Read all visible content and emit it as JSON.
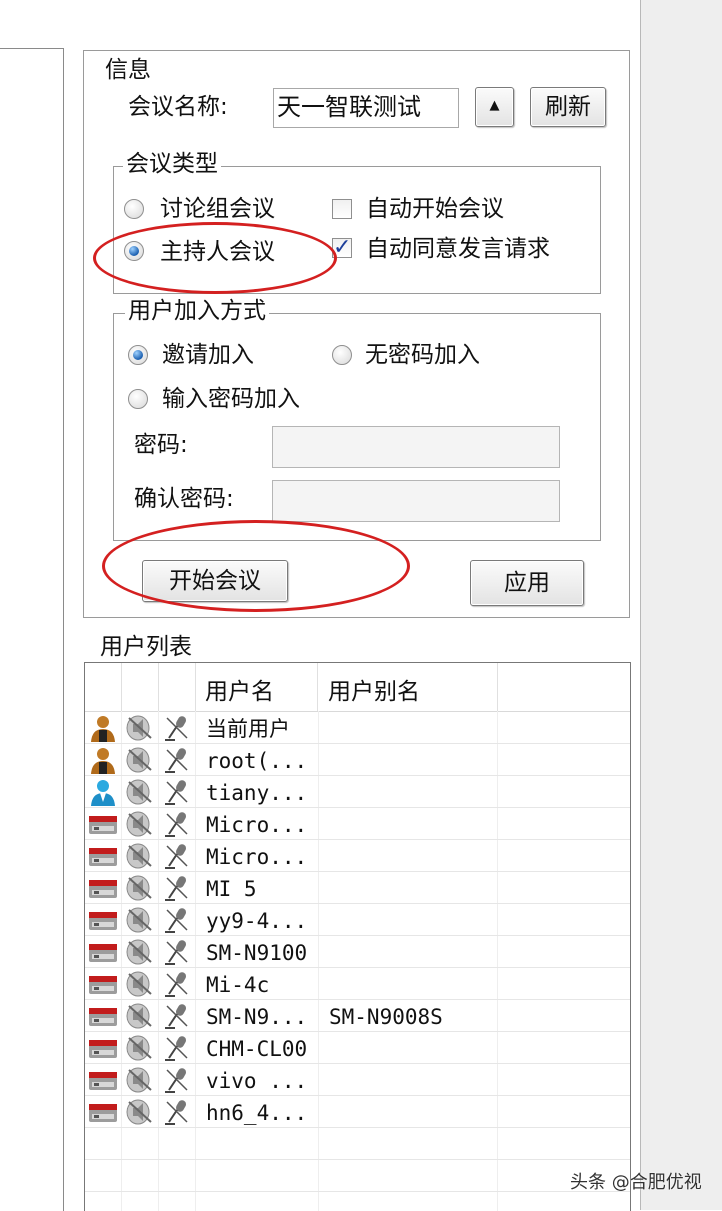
{
  "info": {
    "title": "信息",
    "meeting_name_label": "会议名称:",
    "meeting_name_value": "天一智联测试",
    "up_button": "▲",
    "refresh_button": "刷新"
  },
  "meeting_type": {
    "title": "会议类型",
    "options": [
      "讨论组会议",
      "主持人会议"
    ],
    "selected": "主持人会议",
    "checks": [
      {
        "label": "自动开始会议",
        "checked": false
      },
      {
        "label": "自动同意发言请求",
        "checked": true
      }
    ]
  },
  "join_mode": {
    "title": "用户加入方式",
    "options": [
      "邀请加入",
      "无密码加入",
      "输入密码加入"
    ],
    "selected": "邀请加入",
    "password_label": "密码:",
    "confirm_label": "确认密码:"
  },
  "actions": {
    "start": "开始会议",
    "apply": "应用"
  },
  "user_list": {
    "title": "用户列表",
    "columns": [
      "用户名",
      "用户别名"
    ],
    "rows": [
      {
        "name": "当前用户",
        "alias": "",
        "type": "person-icon"
      },
      {
        "name": "root(...",
        "alias": "",
        "type": "person-icon"
      },
      {
        "name": "tiany...",
        "alias": "",
        "type": "user-blue-icon"
      },
      {
        "name": "Micro...",
        "alias": "",
        "type": "device-icon"
      },
      {
        "name": "Micro...",
        "alias": "",
        "type": "device-icon"
      },
      {
        "name": "MI 5",
        "alias": "",
        "type": "device-icon"
      },
      {
        "name": "yy9-4...",
        "alias": "",
        "type": "device-icon"
      },
      {
        "name": "SM-N9100",
        "alias": "",
        "type": "device-icon"
      },
      {
        "name": "Mi-4c",
        "alias": "",
        "type": "device-icon"
      },
      {
        "name": "SM-N9...",
        "alias": "SM-N9008S",
        "type": "device-icon"
      },
      {
        "name": "CHM-CL00",
        "alias": "",
        "type": "device-icon"
      },
      {
        "name": "vivo ...",
        "alias": "",
        "type": "device-icon"
      },
      {
        "name": "hn6_4...",
        "alias": "",
        "type": "device-icon"
      }
    ]
  },
  "watermark": "头条 @合肥优视",
  "colors": {
    "highlight_ellipse": "#d42020",
    "radio_selected": "#1a5fb0",
    "device_red": "#c21c1c"
  }
}
